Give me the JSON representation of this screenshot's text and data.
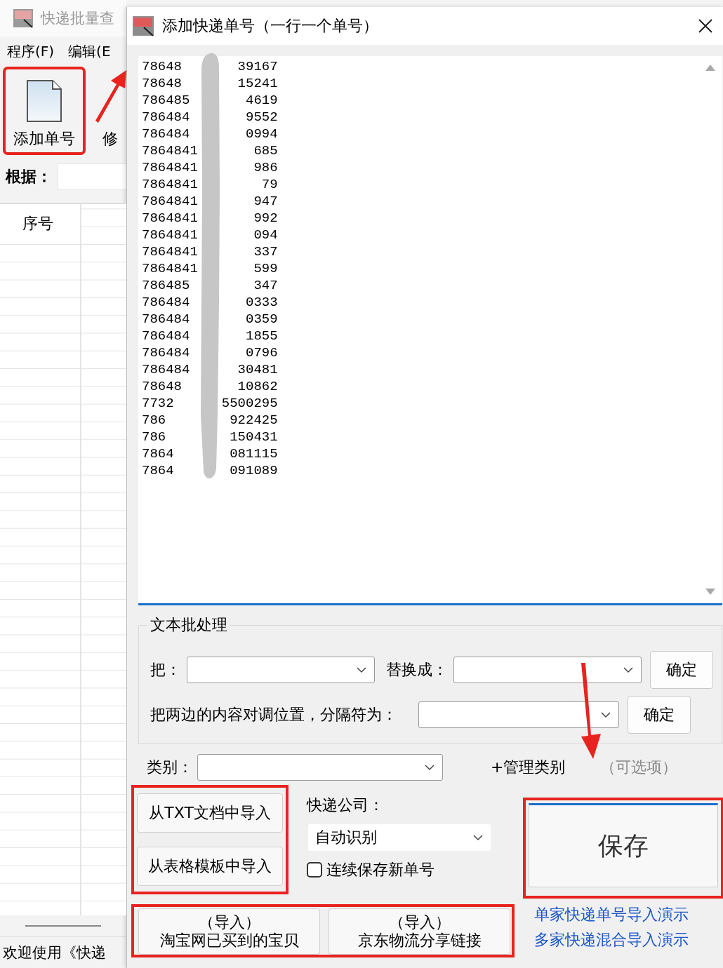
{
  "main_window": {
    "title": "快递批量查",
    "menu": [
      "程序(F)",
      "编辑(E"
    ],
    "toolbar": [
      {
        "label": "添加单号",
        "highlighted": true
      },
      {
        "label": "修",
        "highlighted": false
      }
    ],
    "filter_label": "根据：",
    "table": {
      "columns": [
        "序号"
      ]
    },
    "status_bar": "欢迎使用《快递"
  },
  "dialog": {
    "title": "添加快递单号（一行一个单号）",
    "numbers": [
      {
        "start": "78648",
        "end": "39167"
      },
      {
        "start": "78648",
        "end": "15241"
      },
      {
        "start": "786485",
        "end": "4619"
      },
      {
        "start": "786484",
        "end": "9552"
      },
      {
        "start": "786484",
        "end": "0994"
      },
      {
        "start": "7864841",
        "end": "685"
      },
      {
        "start": "7864841",
        "end": "986"
      },
      {
        "start": "7864841",
        "end": "79"
      },
      {
        "start": "7864841",
        "end": "947"
      },
      {
        "start": "7864841",
        "end": "992"
      },
      {
        "start": "7864841",
        "end": "094"
      },
      {
        "start": "7864841",
        "end": "337"
      },
      {
        "start": "7864841",
        "end": "599"
      },
      {
        "start": "786485",
        "end": "347"
      },
      {
        "start": "786484",
        "end": "0333"
      },
      {
        "start": "786484",
        "end": "0359"
      },
      {
        "start": "786484",
        "end": "1855"
      },
      {
        "start": "786484",
        "end": "0796"
      },
      {
        "start": "786484",
        "end": "30481"
      },
      {
        "start": "78648",
        "end": "10862"
      },
      {
        "start": "7732",
        "end": "5500295"
      },
      {
        "start": "786",
        "end": "922425"
      },
      {
        "start": "786",
        "end": "150431"
      },
      {
        "start": "7864",
        "end": "081115"
      },
      {
        "start": "7864",
        "end": "091089"
      }
    ],
    "batch": {
      "title": "文本批处理",
      "replace_label": "把：",
      "with_label": "替换成：",
      "replace_ok": "确定",
      "swap_label": "把两边的内容对调位置，分隔符为：",
      "swap_ok": "确定"
    },
    "category": {
      "label": "类别：",
      "manage": "+管理类别",
      "hint": "（可选项）"
    },
    "import_group": {
      "highlighted": true,
      "buttons": [
        "从TXT文档中导入",
        "从表格模板中导入"
      ]
    },
    "courier": {
      "label": "快递公司：",
      "value": "自动识别"
    },
    "continuous_save": {
      "label": "连续保存新单号",
      "checked": false
    },
    "save": {
      "label": "保存",
      "highlighted": true
    },
    "shop_group": {
      "highlighted": true,
      "buttons": [
        {
          "line1": "（导入）",
          "line2": "淘宝网已买到的宝贝"
        },
        {
          "line1": "（导入）",
          "line2": "京东物流分享链接"
        }
      ]
    },
    "demo_links": [
      "单家快递单号导入演示",
      "多家快递混合导入演示"
    ]
  }
}
